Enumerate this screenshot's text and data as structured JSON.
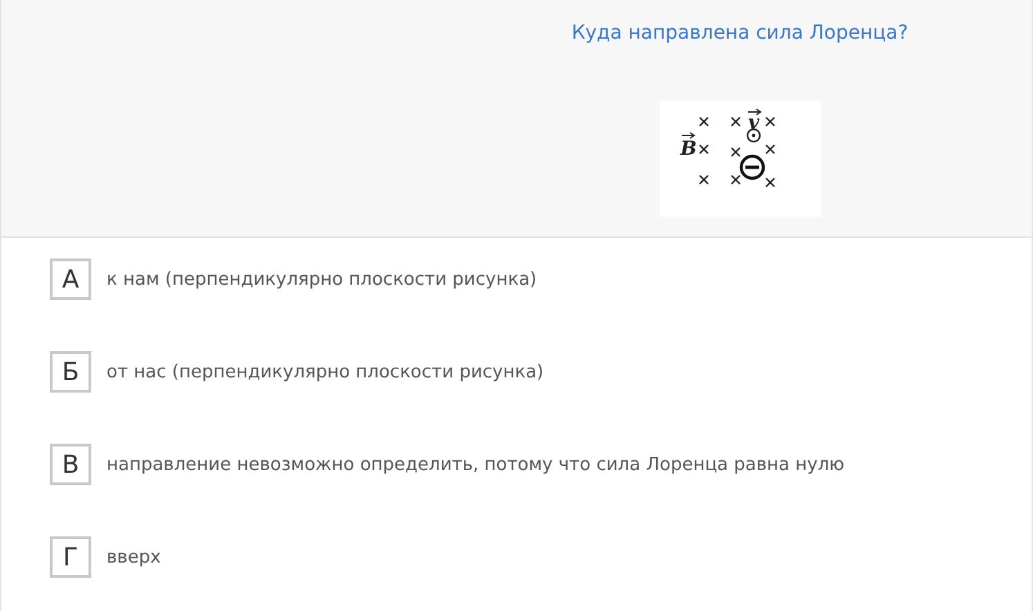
{
  "question": {
    "text": "Куда направлена сила Лоренца?",
    "figure": {
      "field_label": "B",
      "velocity_label": "v"
    }
  },
  "options": [
    {
      "letter": "А",
      "text": "к нам (перпендикулярно плоскости рисунка)"
    },
    {
      "letter": "Б",
      "text": "от нас (перпендикулярно плоскости рисунка)"
    },
    {
      "letter": "В",
      "text": "направление невозможно определить, потому что сила Лоренца равна нулю"
    },
    {
      "letter": "Г",
      "text": "вверх"
    }
  ]
}
